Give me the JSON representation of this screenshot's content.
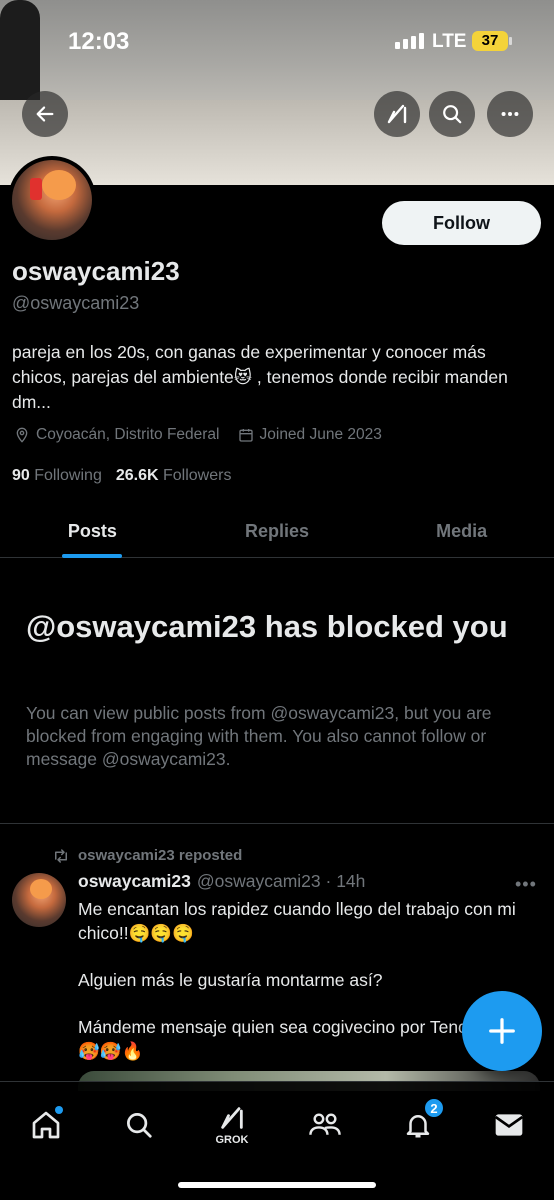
{
  "status_bar": {
    "time": "12:03",
    "network": "LTE",
    "battery": "37"
  },
  "profile": {
    "display_name": "oswaycami23",
    "handle": "@oswaycami23",
    "follow_label": "Follow",
    "bio": "pareja en los 20s, con ganas de experimentar y conocer más chicos, parejas del ambiente😻 , tenemos donde recibir manden dm...",
    "location": "Coyoacán, Distrito Federal",
    "joined": "Joined June 2023",
    "following_count": "90",
    "following_label": "Following",
    "followers_count": "26.6K",
    "followers_label": "Followers"
  },
  "tabs": [
    {
      "label": "Posts",
      "active": true
    },
    {
      "label": "Replies",
      "active": false
    },
    {
      "label": "Media",
      "active": false
    }
  ],
  "blocked": {
    "title": "@oswaycami23 has blocked you",
    "body": "You can view public posts from @oswaycami23, but you are blocked from engaging with them. You also cannot follow or message @oswaycami23."
  },
  "post": {
    "repost_label": "oswaycami23 reposted",
    "author_name": "oswaycami23",
    "author_handle_time": "@oswaycami23 · 14h",
    "paragraphs": [
      "Me encantan los rapidez cuando llego del trabajo con mi chico!!🤤🤤🤤",
      "Alguien más le gustaría montarme así?",
      "Mándeme mensaje quien sea cogivecino por Tenorios!!!🥵🥵🥵🔥"
    ]
  },
  "bottom_nav": {
    "grok_label": "GROK",
    "notification_count": "2"
  },
  "colors": {
    "accent": "#1d9bf0",
    "background": "#000000",
    "muted": "#71767b"
  }
}
